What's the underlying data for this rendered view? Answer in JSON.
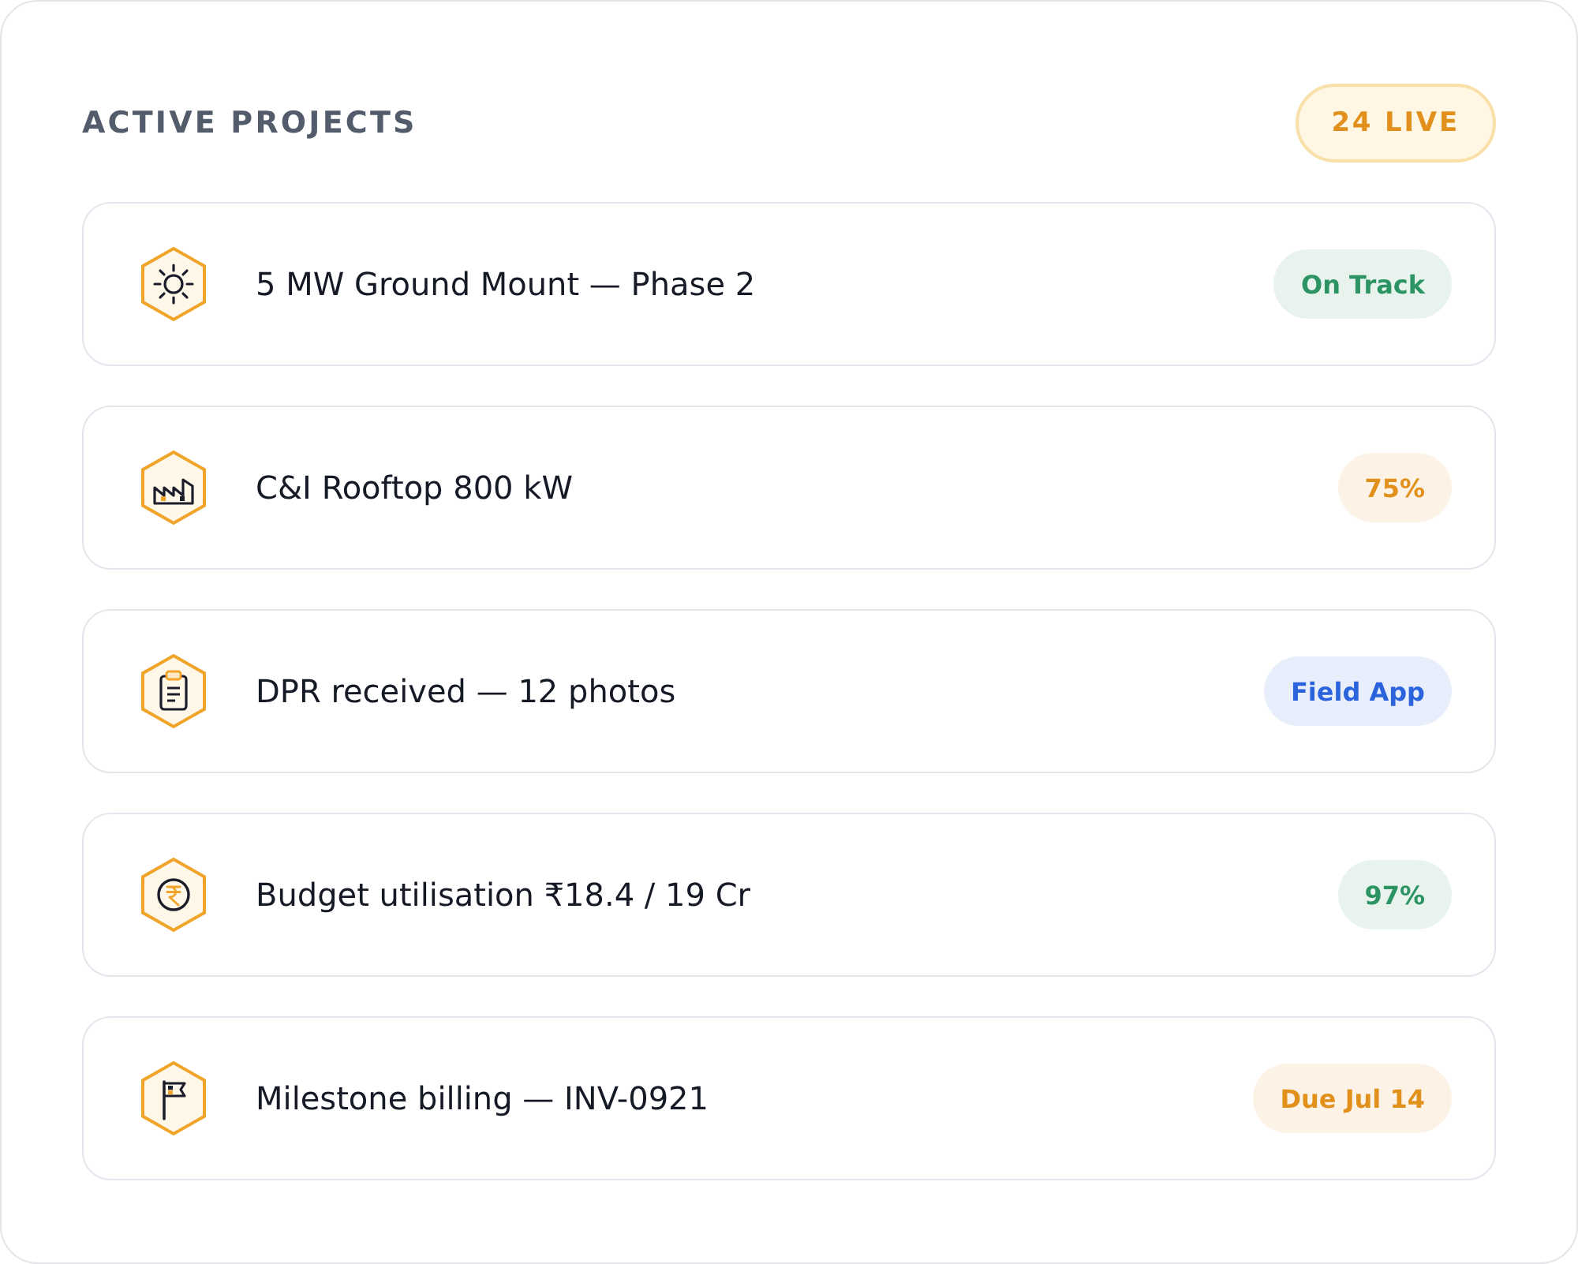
{
  "panel": {
    "title": "ACTIVE PROJECTS",
    "live_badge": "24 LIVE"
  },
  "projects": [
    {
      "title": "5 MW Ground Mount — Phase 2",
      "badge": {
        "label": "On Track",
        "color": "#2b9462"
      }
    },
    {
      "title": "C&I Rooftop 800 kW",
      "badge": {
        "label": "75%",
        "color": "#e0901b"
      }
    },
    {
      "title": "DPR received — 12 photos",
      "badge": {
        "label": "Field App",
        "color": "#2b63dc"
      }
    },
    {
      "title": "Budget utilisation ₹18.4 / 19 Cr",
      "badge": {
        "label": "97%",
        "color": "#2b9462"
      }
    },
    {
      "title": "Milestone billing — INV-0921",
      "badge": {
        "label": "Due Jul 14",
        "color": "#e0901b"
      }
    }
  ]
}
